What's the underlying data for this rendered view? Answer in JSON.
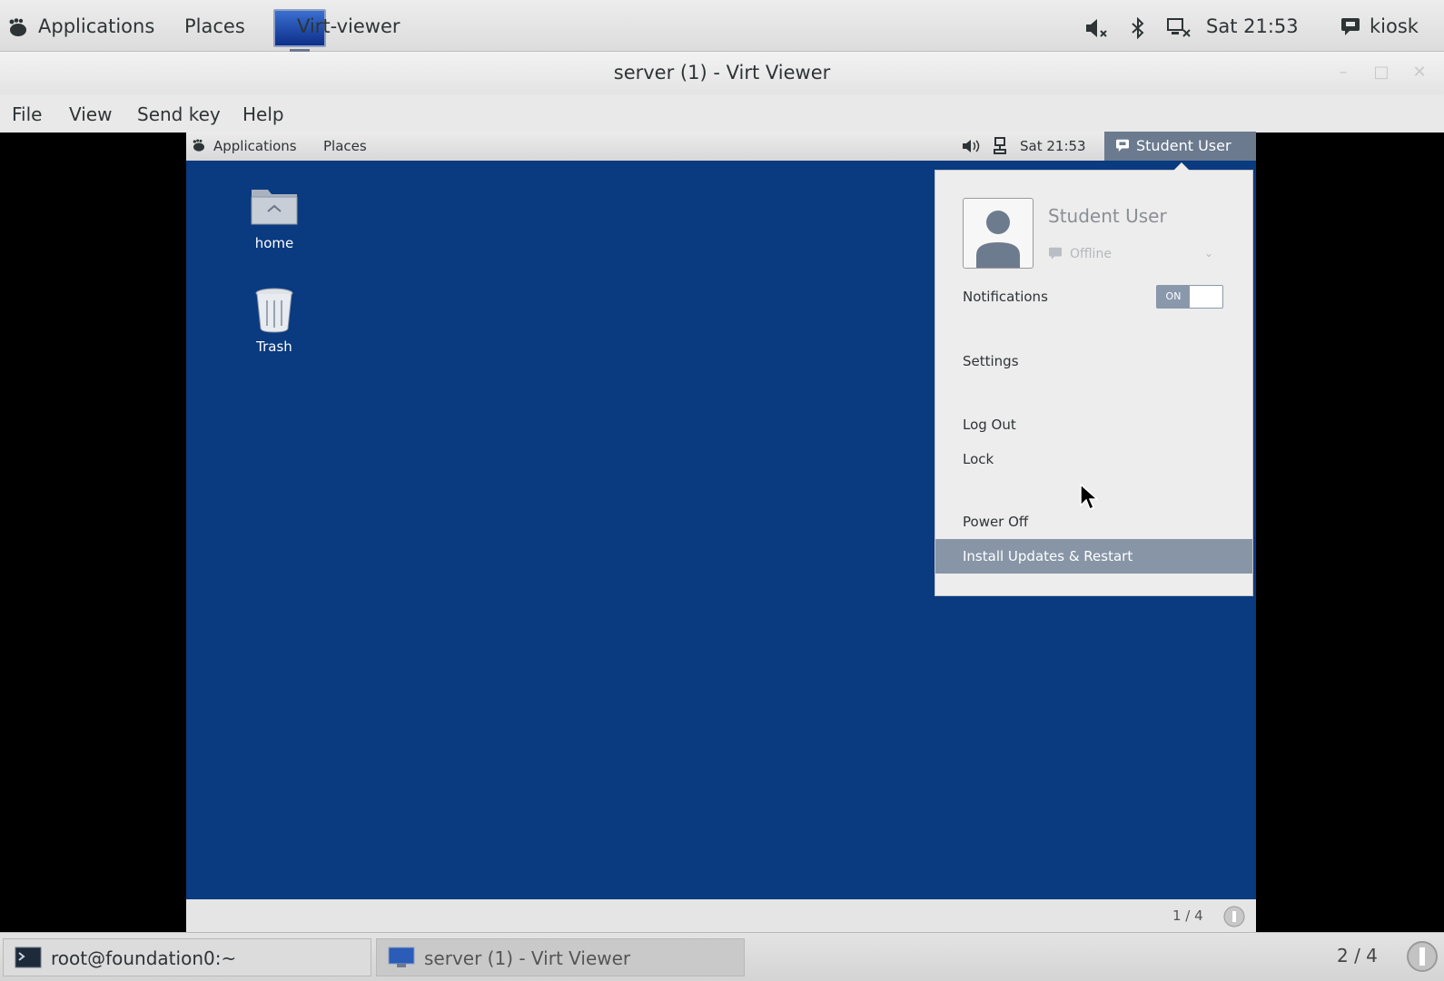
{
  "host_panel": {
    "applications": "Applications",
    "places": "Places",
    "window_title": "Virt-viewer",
    "clock": "Sat 21:53",
    "user": "kiosk"
  },
  "window": {
    "title": "server (1) - Virt Viewer",
    "menu": [
      "File",
      "View",
      "Send key",
      "Help"
    ]
  },
  "guest_panel": {
    "applications": "Applications",
    "places": "Places",
    "clock": "Sat 21:53",
    "user_button": "Student User"
  },
  "desktop_icons": {
    "home": "home",
    "trash": "Trash"
  },
  "user_menu": {
    "name": "Student User",
    "status": "Offline",
    "notifications_label": "Notifications",
    "toggle_state": "ON",
    "settings": "Settings",
    "log_out": "Log Out",
    "lock": "Lock",
    "power_off": "Power Off",
    "install_updates": "Install Updates & Restart"
  },
  "guest_workspace": "1 / 4",
  "host_taskbar": {
    "terminal": "root@foundation0:~",
    "viewer": "server (1) - Virt Viewer",
    "workspace": "2 / 4"
  }
}
